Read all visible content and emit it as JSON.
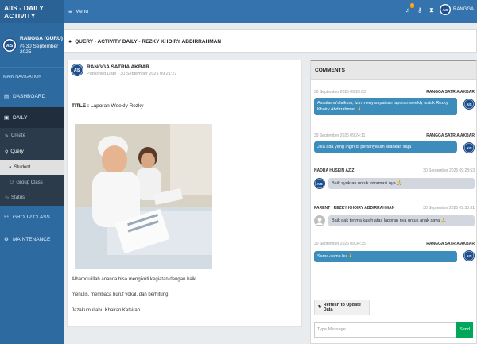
{
  "app": {
    "brand": "AIIS - DAILY ACTIVITY",
    "menu_label": "Menu"
  },
  "topbar": {
    "notification_count": "4",
    "user_name": "RANGGA"
  },
  "sidebar": {
    "user_name": "RANGGA (GURU)",
    "user_date": "30 September 2025",
    "nav_header": "MAIN NAVIGATION",
    "items": {
      "dashboard": "DASHBOARD",
      "daily": "DAILY",
      "create": "Create",
      "query": "Query",
      "student": "Student",
      "group_class_sub": "Group Class",
      "status": "Status",
      "group_class": "GROUP CLASS",
      "maintenance": "MAINTENANCE"
    }
  },
  "page": {
    "header_title": "QUERY - ACTIVITY DAILY - REZKY KHOIRY ABDIRRAHMAN"
  },
  "post": {
    "author": "RANGGA SATRIA AKBAR",
    "published": "Published Date - 30 September 2025 09:21:27",
    "title_label": "TITLE :",
    "title_value": "Laporan Weekly Rezky",
    "body_lines": [
      "Alhamdulillah ananda bisa mengikuti kegiatan dengan baik",
      "menulis, membaca huruf vokal, dan berhitung",
      "Jazakumullahu Khairan Katsiran"
    ]
  },
  "comments": {
    "title": "COMMENTS",
    "messages": [
      {
        "time": "30 September 2025 09:23:03",
        "name": "RANGGA SATRIA AKBAR",
        "text": "Assalamu'alaikum, Izin menyampaikan laporan weekly untuk Rezky Khoiry Abdirrahman 🙏",
        "side": "right"
      },
      {
        "time": "30 September 2025 09:24:11",
        "name": "RANGGA SATRIA AKBAR",
        "text": "Jika ada yang ingin di pertanyakan silahkan saja",
        "side": "right"
      },
      {
        "time": "30 September 2025 09:28:53",
        "name": "NADRA HUSEIN AZIZ",
        "text": "Baik syukran untuk informasi nya 🙏",
        "side": "left"
      },
      {
        "time": "30 September 2025 09:30:31",
        "name": "PARENT : REZKY KHOIRY ABDIRRAHMAN",
        "text": "Baik pak terima kasih atas laporan nya untuk anak saya 🙏",
        "side": "left"
      },
      {
        "time": "30 September 2025 09:34:35",
        "name": "RANGGA SATRIA AKBAR",
        "text": "Sama-sama bu 🙏",
        "side": "right"
      }
    ],
    "refresh_label": "Refresh to Update Data",
    "input_placeholder": "Type Message ...",
    "send_label": "Send"
  },
  "colors": {
    "sidebar": "#2c6aa0",
    "topbar": "#3473ad",
    "bubble_right": "#3c8dbc",
    "bubble_left": "#d2d6de",
    "send": "#00a65a"
  }
}
